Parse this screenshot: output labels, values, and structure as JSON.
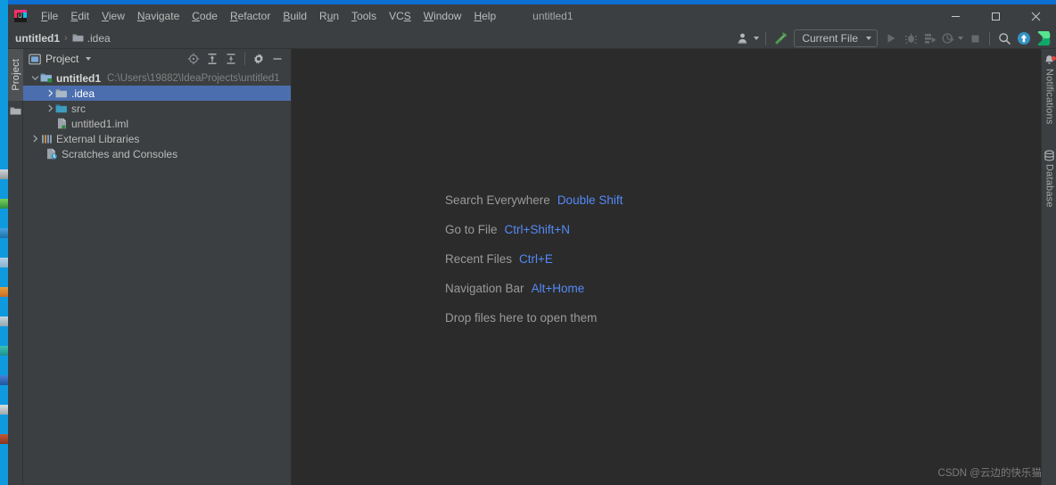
{
  "window": {
    "title": "untitled1",
    "accent_top_bar": "#0d6fd1",
    "app_icon": "intellij-idea-logo",
    "controls": {
      "minimize": "minimize-icon",
      "maximize": "maximize-icon",
      "close": "close-icon"
    }
  },
  "menu": {
    "items": [
      {
        "label": "File",
        "mnemonic": "F"
      },
      {
        "label": "Edit",
        "mnemonic": "E"
      },
      {
        "label": "View",
        "mnemonic": "V"
      },
      {
        "label": "Navigate",
        "mnemonic": "N"
      },
      {
        "label": "Code",
        "mnemonic": "C"
      },
      {
        "label": "Refactor",
        "mnemonic": "R"
      },
      {
        "label": "Build",
        "mnemonic": "B"
      },
      {
        "label": "Run",
        "mnemonic": "u"
      },
      {
        "label": "Tools",
        "mnemonic": "T"
      },
      {
        "label": "VCS",
        "mnemonic": "S"
      },
      {
        "label": "Window",
        "mnemonic": "W"
      },
      {
        "label": "Help",
        "mnemonic": "H"
      }
    ]
  },
  "breadcrumb": {
    "project": "untitled1",
    "separator": "›",
    "folder": ".idea",
    "folder_icon": "folder-icon"
  },
  "main_toolbar": {
    "account_icon": "user-account-icon",
    "build_icon": "build-hammer-icon",
    "run_config": {
      "label": "Current File",
      "dropdown_icon": "chevron-down-icon"
    },
    "run_icon": "run-play-icon",
    "debug_icon": "debug-bug-icon",
    "run_coverage_icon": "run-with-coverage-icon",
    "profile_icon": "profiler-icon",
    "stop_icon": "stop-square-icon",
    "search_icon": "search-icon",
    "update_icon": "update-arrow-icon",
    "code_with_me_icon": "code-with-me-icon"
  },
  "left_tool_strip": {
    "active_tab": "Project",
    "secondary_icon": "folder-icon"
  },
  "project_panel": {
    "title": "Project",
    "title_icon": "project-view-icon",
    "dropdown_icon": "chevron-down-icon",
    "actions": [
      {
        "name": "scroll-from-source-icon",
        "tooltip": "Select Opened File"
      },
      {
        "name": "expand-all-icon",
        "tooltip": "Expand All"
      },
      {
        "name": "collapse-all-icon",
        "tooltip": "Collapse All"
      },
      {
        "name": "gear-icon",
        "tooltip": "Options"
      },
      {
        "name": "hide-icon",
        "tooltip": "Hide"
      }
    ],
    "tree": [
      {
        "label": "untitled1",
        "path": "C:\\Users\\19882\\IdeaProjects\\untitled1",
        "icon": "project-module-icon",
        "indent": 0,
        "expanded": true,
        "bold": true,
        "selected": false
      },
      {
        "label": ".idea",
        "path": "",
        "icon": "folder-icon",
        "indent": 1,
        "expanded": false,
        "bold": false,
        "selected": true
      },
      {
        "label": "src",
        "path": "",
        "icon": "source-folder-icon",
        "indent": 1,
        "expanded": false,
        "bold": false,
        "selected": false
      },
      {
        "label": "untitled1.iml",
        "path": "",
        "icon": "iml-file-icon",
        "indent": 1,
        "expanded": null,
        "bold": false,
        "selected": false
      },
      {
        "label": "External Libraries",
        "path": "",
        "icon": "external-libraries-icon",
        "indent": 0,
        "expanded": false,
        "bold": false,
        "selected": false
      },
      {
        "label": "Scratches and Consoles",
        "path": "",
        "icon": "scratches-icon",
        "indent": 0,
        "expanded": null,
        "bold": false,
        "selected": false
      }
    ]
  },
  "editor_welcome": {
    "hints": [
      {
        "label": "Search Everywhere",
        "shortcut": "Double Shift"
      },
      {
        "label": "Go to File",
        "shortcut": "Ctrl+Shift+N"
      },
      {
        "label": "Recent Files",
        "shortcut": "Ctrl+E"
      },
      {
        "label": "Navigation Bar",
        "shortcut": "Alt+Home"
      },
      {
        "label": "Drop files here to open them",
        "shortcut": ""
      }
    ],
    "watermark": "CSDN @云边的快乐猫"
  },
  "right_tool_strip": {
    "tabs": [
      {
        "label": "Notifications",
        "icon": "notifications-bell-icon",
        "badge": true
      },
      {
        "label": "Database",
        "icon": "database-icon",
        "badge": false
      }
    ]
  },
  "colors": {
    "window_chrome": "#3c3f41",
    "editor_bg": "#2b2b2b",
    "selection_blue": "#4b6eaf",
    "shortcut_blue": "#548af7",
    "text_primary": "#bbbbbb",
    "text_muted": "#808080",
    "title_accent": "#0d6fd1",
    "badge_red": "#e0453e",
    "build_green": "#499c54"
  }
}
